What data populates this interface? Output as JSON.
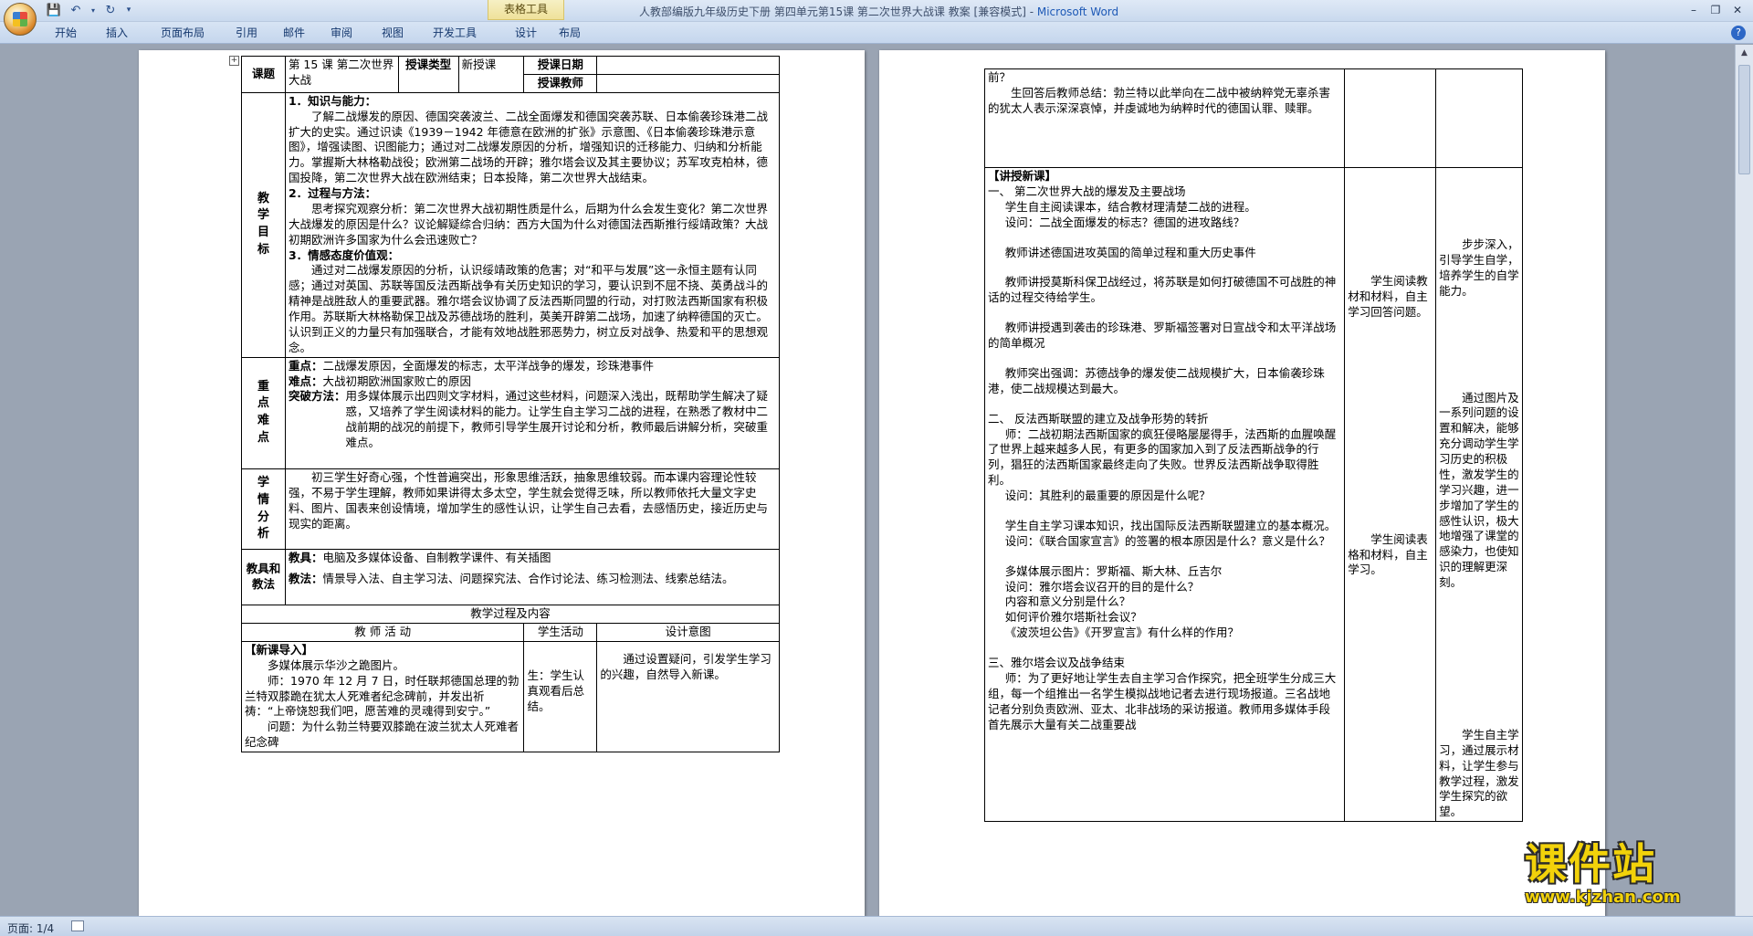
{
  "window": {
    "title": "人教部编版九年级历史下册 第四单元第15课 第二次世界大战课 教案 [兼容模式] - ",
    "app_name": "Microsoft Word",
    "context_tab_label": "表格工具"
  },
  "ribbon": {
    "tabs": [
      "开始",
      "插入",
      "页面布局",
      "引用",
      "邮件",
      "审阅",
      "视图",
      "开发工具",
      "设计",
      "布局"
    ]
  },
  "status": {
    "page": "页面: 1/4"
  },
  "watermark": {
    "brand": "课件站",
    "url": "www.kjzhan.com"
  },
  "page1": {
    "header": {
      "lesson_label": "课题",
      "lesson_title": "第 15 课 第二次世界大战",
      "type_label": "授课类型",
      "type_value": "新授课",
      "date_label": "授课日期",
      "teacher_label": "授课教师"
    },
    "objectives": {
      "label": "教学目标",
      "h1": "1．知识与能力：",
      "p1": "了解二战爆发的原因、德国突袭波兰、二战全面爆发和德国突袭苏联、日本偷袭珍珠港二战扩大的史实。通过识读《1939－1942 年德意在欧洲的扩张》示意图、《日本偷袭珍珠港示意图》，增强读图、识图能力；通过对二战爆发原因的分析，增强知识的迁移能力、归纳和分析能力。掌握斯大林格勒战役；欧洲第二战场的开辟；雅尔塔会议及其主要协议；苏军攻克柏林，德国投降，第二次世界大战在欧洲结束；日本投降，第二次世界大战结束。",
      "h2": "2．过程与方法：",
      "p2": "思考探究观察分析：第二次世界大战初期性质是什么，后期为什么会发生变化？第二次世界大战爆发的原因是什么？议论解疑综合归纳：西方大国为什么对德国法西斯推行绥靖政策？大战初期欧洲许多国家为什么会迅速败亡？",
      "h3": "3．情感态度价值观：",
      "p3": "通过对二战爆发原因的分析，认识绥靖政策的危害；对“和平与发展”这一永恒主题有认同感；通过对英国、苏联等国反法西斯战争有关历史知识的学习，要认识到不屈不挠、英勇战斗的精神是战胜敌人的重要武器。雅尔塔会议协调了反法西斯同盟的行动，对打败法西斯国家有积极作用。苏联斯大林格勒保卫战及苏德战场的胜利，英美开辟第二战场，加速了纳粹德国的灭亡。认识到正义的力量只有加强联合，才能有效地战胜邪恶势力，树立反对战争、热爱和平的思想观念。"
    },
    "keypoints": {
      "label": "重点难点",
      "key_label": "重点：",
      "key": "二战爆发原因，全面爆发的标志，太平洋战争的爆发，珍珠港事件",
      "diff_label": "难点：",
      "diff": "大战初期欧洲国家败亡的原因",
      "method_label": "突破方法：",
      "method": "用多媒体展示出四则文字材料，通过这些材料，问题深入浅出，既帮助学生解决了疑惑，又培养了学生阅读材料的能力。让学生自主学习二战的进程，在熟悉了教材中二战前期的战况的前提下，教师引导学生展开讨论和分析，教师最后讲解分析，突破重难点。"
    },
    "analysis": {
      "label": "学情分析",
      "text": "初三学生好奇心强，个性普遍突出，形象思维活跃，抽象思维较弱。而本课内容理论性较强，不易于学生理解，教师如果讲得太多太空，学生就会觉得乏味，所以教师依托大量文字史料、图片、国表来创设情境，增加学生的感性认识，让学生自己去看，去感悟历史，接近历史与现实的距离。"
    },
    "tools": {
      "label": "教具和教法",
      "tool_label": "教具：",
      "tool": "电脑及多媒体设备、自制教学课件、有关插图",
      "method_label": "教法：",
      "method": "情景导入法、自主学习法、问题探究法、合作讨论法、练习检测法、线索总结法。"
    },
    "process": {
      "title": "教学过程及内容",
      "col_teacher": "教 师 活 动",
      "col_student": "学生活动",
      "col_intent": "设计意图",
      "intro_heading": "【新课导入】",
      "intro_lines": [
        "多媒体展示华沙之跪图片。",
        "师：1970 年 12 月 7 日，时任联邦德国总理的勃兰特双膝跪在犹太人死难者纪念碑前，并发出祈祷：“上帝饶恕我们吧，愿苦难的灵魂得到安宁。”",
        "问题：为什么勃兰特要双膝跪在波兰犹太人死难者纪念碑"
      ],
      "intro_student": "生：学生认真观看后总结。",
      "intro_intent": "通过设置疑问，引发学生学习的兴趣，自然导入新课。"
    }
  },
  "page2": {
    "top_lines": [
      "前？",
      "生回答后教师总结：勃兰特以此举向在二战中被纳粹党无辜杀害的犹太人表示深深哀悼，并虔诚地为纳粹时代的德国认罪、赎罪。"
    ],
    "teach_heading": "【讲授新课】",
    "teach_lines": [
      "一、 第二次世界大战的爆发及主要战场",
      "学生自主阅读课本，结合教材理清楚二战的进程。",
      "设问：二战全面爆发的标志？德国的进攻路线？",
      "",
      "教师讲述德国进攻英国的简单过程和重大历史事件",
      "",
      "教师讲授莫斯科保卫战经过，将苏联是如何打破德国不可战胜的神话的过程交待给学生。",
      "",
      "教师讲授遇到袭击的珍珠港、罗斯福签署对日宣战令和太平洋战场的简单概况",
      "",
      "教师突出强调：苏德战争的爆发使二战规模扩大，日本偷袭珍珠港，使二战规模达到最大。",
      "",
      "二、 反法西斯联盟的建立及战争形势的转折",
      "师：二战初期法西斯国家的疯狂侵略屡屡得手，法西斯的血腥唤醒了世界上越来越多人民，有更多的国家加入到了反法西斯战争的行列，猖狂的法西斯国家最终走向了失败。世界反法西斯战争取得胜利。",
      "设问：其胜利的最重要的原因是什么呢？",
      "",
      "学生自主学习课本知识，找出国际反法西斯联盟建立的基本概况。",
      "设问：《联合国家宣言》的签署的根本原因是什么？意义是什么？",
      "",
      "多媒体展示图片：罗斯福、斯大林、丘吉尔",
      "设问：雅尔塔会议召开的目的是什么？",
      "内容和意义分别是什么？",
      "如何评价雅尔塔斯社会议？",
      "《波茨坦公告》《开罗宣言》有什么样的作用？",
      "",
      "三、雅尔塔会议及战争结束",
      "师：为了更好地让学生去自主学习合作探究，把全班学生分成三大组，每一个组推出一名学生模拟战地记者去进行现场报道。三名战地记者分别负责欧洲、亚太、北非战场的采访报道。教师用多媒体手段首先展示大量有关二战重要战"
    ],
    "student_a": "学生阅读教材和材料，自主学习回答问题。",
    "student_b": "学生阅读表格和材料，自主学习。",
    "intent_a": "步步深入，引导学生自学，培养学生的自学能力。",
    "intent_b": "通过图片及一系列问题的设置和解决，能够充分调动学生学习历史的积极性，激发学生的学习兴趣，进一步增加了学生的感性认识，极大地增强了课堂的感染力，也使知识的理解更深刻。",
    "intent_c": "学生自主学习，通过展示材料，让学生参与教学过程，激发学生探究的欲望。"
  }
}
